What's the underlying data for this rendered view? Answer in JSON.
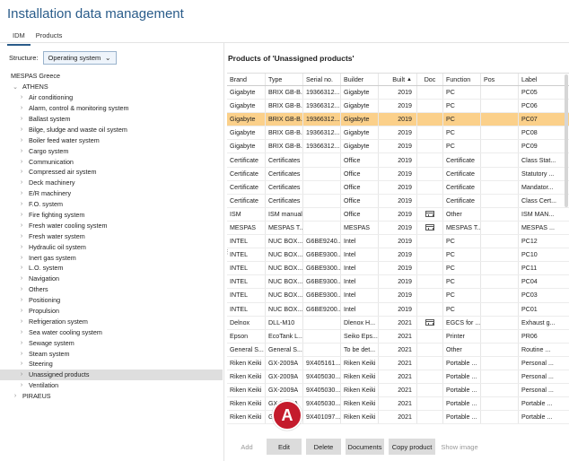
{
  "app": {
    "title": "Installation data management"
  },
  "tabs": [
    {
      "label": "IDM",
      "active": true
    },
    {
      "label": "Products",
      "active": false
    }
  ],
  "structure": {
    "label": "Structure:",
    "selected": "Operating system"
  },
  "tree": {
    "root": "MESPAS Greece",
    "athens": "ATHENS",
    "athens_children": [
      "Air conditioning",
      "Alarm, control & monitoring system",
      "Ballast system",
      "Bilge, sludge and waste oil system",
      "Boiler feed water system",
      "Cargo system",
      "Communication",
      "Compressed air system",
      "Deck machinery",
      "E/R machinery",
      "F.O. system",
      "Fire fighting system",
      "Fresh water cooling system",
      "Fresh water system",
      "Hydraulic oil system",
      "Inert gas system",
      "L.O. system",
      "Navigation",
      "Others",
      "Positioning",
      "Propulsion",
      "Refrigeration system",
      "Sea water cooling system",
      "Sewage system",
      "Steam system",
      "Steering",
      "Unassigned products",
      "Ventilation"
    ],
    "selected": "Unassigned products",
    "piraeus": "PIRAEUS"
  },
  "products": {
    "title": "Products of 'Unassigned products'",
    "columns": [
      "Brand",
      "Type",
      "Serial no.",
      "Builder",
      "Built",
      "Doc",
      "Function",
      "Pos",
      "Label"
    ],
    "rows": [
      [
        "Gigabyte",
        "BRIX GB-B...",
        "19366312...",
        "Gigabyte",
        "2019",
        "",
        "PC",
        "",
        "PC05"
      ],
      [
        "Gigabyte",
        "BRIX GB-B...",
        "19366312...",
        "Gigabyte",
        "2019",
        "",
        "PC",
        "",
        "PC06"
      ],
      [
        "Gigabyte",
        "BRIX GB-B...",
        "19366312...",
        "Gigabyte",
        "2019",
        "",
        "PC",
        "",
        "PC07"
      ],
      [
        "Gigabyte",
        "BRIX GB-B...",
        "19366312...",
        "Gigabyte",
        "2019",
        "",
        "PC",
        "",
        "PC08"
      ],
      [
        "Gigabyte",
        "BRIX GB-B...",
        "19366312...",
        "Gigabyte",
        "2019",
        "",
        "PC",
        "",
        "PC09"
      ],
      [
        "Certificate",
        "Certificates",
        "",
        "Office",
        "2019",
        "",
        "Certificate",
        "",
        "Class Stat..."
      ],
      [
        "Certificate",
        "Certificates",
        "",
        "Office",
        "2019",
        "",
        "Certificate",
        "",
        "Statutory ..."
      ],
      [
        "Certificate",
        "Certificates",
        "",
        "Office",
        "2019",
        "",
        "Certificate",
        "",
        "Mandator..."
      ],
      [
        "Certificate",
        "Certificates",
        "",
        "Office",
        "2019",
        "",
        "Certificate",
        "",
        "Class Cert..."
      ],
      [
        "ISM",
        "ISM manual",
        "",
        "Office",
        "2019",
        "doc",
        "Other",
        "",
        "ISM MAN..."
      ],
      [
        "MESPAS",
        "MESPAS T...",
        "",
        "MESPAS",
        "2019",
        "doc",
        "MESPAS T...",
        "",
        "MESPAS ..."
      ],
      [
        "INTEL",
        "NUC BOX...",
        "G6BE9240...",
        "Intel",
        "2019",
        "",
        "PC",
        "",
        "PC12"
      ],
      [
        "INTEL",
        "NUC BOX...",
        "G6BE9300...",
        "Intel",
        "2019",
        "",
        "PC",
        "",
        "PC10"
      ],
      [
        "INTEL",
        "NUC BOX...",
        "G6BE9300...",
        "Intel",
        "2019",
        "",
        "PC",
        "",
        "PC11"
      ],
      [
        "INTEL",
        "NUC BOX...",
        "G6BE9300...",
        "Intel",
        "2019",
        "",
        "PC",
        "",
        "PC04"
      ],
      [
        "INTEL",
        "NUC BOX...",
        "G6BE9300...",
        "Intel",
        "2019",
        "",
        "PC",
        "",
        "PC03"
      ],
      [
        "INTEL",
        "NUC BOX...",
        "G6BE9200...",
        "Intel",
        "2019",
        "",
        "PC",
        "",
        "PC01"
      ],
      [
        "Delnox",
        "DLL-M10",
        "",
        "Dlenox H...",
        "2021",
        "doc",
        "EGCS for ...",
        "",
        "Exhaust g..."
      ],
      [
        "Epson",
        "EcoTank L...",
        "",
        "Seiko Eps...",
        "2021",
        "",
        "Printer",
        "",
        "PR06"
      ],
      [
        "General S...",
        "General S...",
        "",
        "To be det...",
        "2021",
        "",
        "Other",
        "",
        "Routine ..."
      ],
      [
        "Riken Keiki",
        "GX-2009A",
        "9X405161...",
        "Riken Keiki",
        "2021",
        "",
        "Portable ...",
        "",
        "Personal ..."
      ],
      [
        "Riken Keiki",
        "GX-2009A",
        "9X405030...",
        "Riken Keiki",
        "2021",
        "",
        "Portable ...",
        "",
        "Personal ..."
      ],
      [
        "Riken Keiki",
        "GX-2009A",
        "9X405030...",
        "Riken Keiki",
        "2021",
        "",
        "Portable ...",
        "",
        "Personal ..."
      ],
      [
        "Riken Keiki",
        "GX-2009A",
        "9X405030...",
        "Riken Keiki",
        "2021",
        "",
        "Portable ...",
        "",
        "Portable ..."
      ],
      [
        "Riken Keiki",
        "GX-2009A",
        "9X401097...",
        "Riken Keiki",
        "2021",
        "",
        "Portable ...",
        "",
        "Portable ..."
      ]
    ],
    "highlighted_row": 2,
    "doc_icon": "document-icon",
    "sort_icon": "sort-ascending-icon"
  },
  "badge": {
    "label": "A",
    "color": "#c41b2c"
  },
  "buttons": {
    "add": "Add",
    "edit": "Edit",
    "delete": "Delete",
    "documents": "Documents",
    "copy": "Copy product",
    "show_image": "Show image"
  },
  "colors": {
    "accent": "#2a5c8a",
    "highlight": "#fbd08a",
    "selection": "#dedede"
  }
}
